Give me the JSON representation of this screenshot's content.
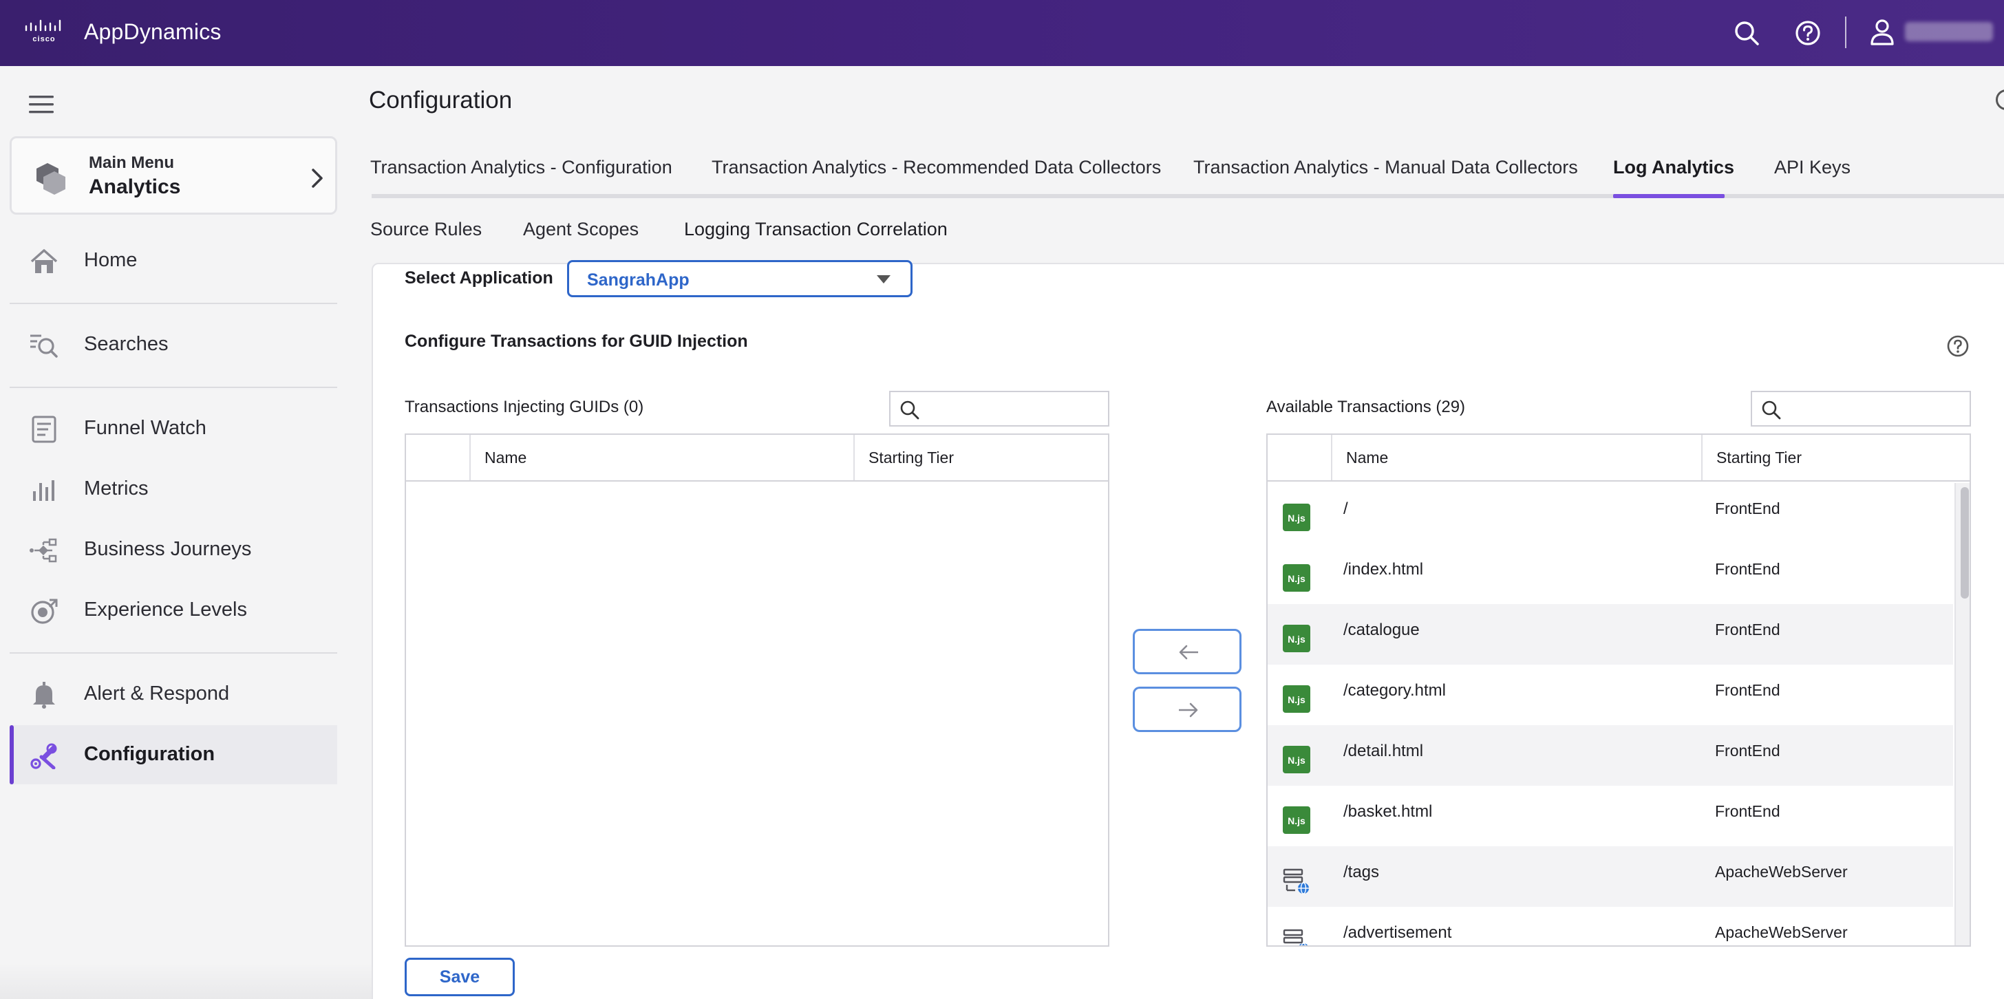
{
  "header": {
    "brand_logo": "cisco-logo",
    "app_name": "AppDynamics",
    "icons": [
      "search-icon",
      "help-icon",
      "user-icon"
    ],
    "colors": {
      "bar": "#43237e",
      "accent": "#7a4fe0",
      "link": "#2e66c9"
    }
  },
  "sidebar": {
    "menu_icon": "hamburger-icon",
    "main_menu": {
      "label": "Main Menu",
      "title": "Analytics"
    },
    "items": [
      {
        "label": "Home",
        "icon": "home-icon"
      },
      {
        "label": "Searches",
        "icon": "search-list-icon"
      },
      {
        "label": "Funnel Watch",
        "icon": "funnel-page-icon"
      },
      {
        "label": "Metrics",
        "icon": "bar-chart-icon"
      },
      {
        "label": "Business Journeys",
        "icon": "journey-icon"
      },
      {
        "label": "Experience Levels",
        "icon": "gauge-icon"
      },
      {
        "label": "Alert & Respond",
        "icon": "bell-icon"
      },
      {
        "label": "Configuration",
        "icon": "wrench-gear-icon",
        "active": true
      }
    ]
  },
  "main": {
    "title": "Configuration",
    "tabs": [
      {
        "label": "Transaction Analytics - Configuration"
      },
      {
        "label": "Transaction Analytics - Recommended Data Collectors"
      },
      {
        "label": "Transaction Analytics - Manual Data Collectors"
      },
      {
        "label": "Log Analytics",
        "active": true
      },
      {
        "label": "API Keys"
      }
    ],
    "subtabs": [
      {
        "label": "Source Rules"
      },
      {
        "label": "Agent Scopes"
      },
      {
        "label": "Logging Transaction Correlation",
        "active": true
      }
    ],
    "select_application": {
      "label": "Select Application",
      "value": "SangrahApp"
    },
    "configure_title": "Configure Transactions for GUID Injection",
    "left_list": {
      "title": "Transactions Injecting GUIDs (0)",
      "columns": [
        "Name",
        "Starting Tier"
      ],
      "rows": []
    },
    "right_list": {
      "title": "Available Transactions (29)",
      "columns": [
        "Name",
        "Starting Tier"
      ],
      "rows": [
        {
          "name": "/",
          "tier": "FrontEnd",
          "icon": "nodejs-icon"
        },
        {
          "name": "/index.html",
          "tier": "FrontEnd",
          "icon": "nodejs-icon"
        },
        {
          "name": "/catalogue",
          "tier": "FrontEnd",
          "icon": "nodejs-icon"
        },
        {
          "name": "/category.html",
          "tier": "FrontEnd",
          "icon": "nodejs-icon"
        },
        {
          "name": "/detail.html",
          "tier": "FrontEnd",
          "icon": "nodejs-icon"
        },
        {
          "name": "/basket.html",
          "tier": "FrontEnd",
          "icon": "nodejs-icon"
        },
        {
          "name": "/tags",
          "tier": "ApacheWebServer",
          "icon": "web-server-icon"
        },
        {
          "name": "/advertisement",
          "tier": "ApacheWebServer",
          "icon": "web-server-icon"
        }
      ]
    },
    "nodejs_badge": "N.js",
    "save_label": "Save"
  }
}
